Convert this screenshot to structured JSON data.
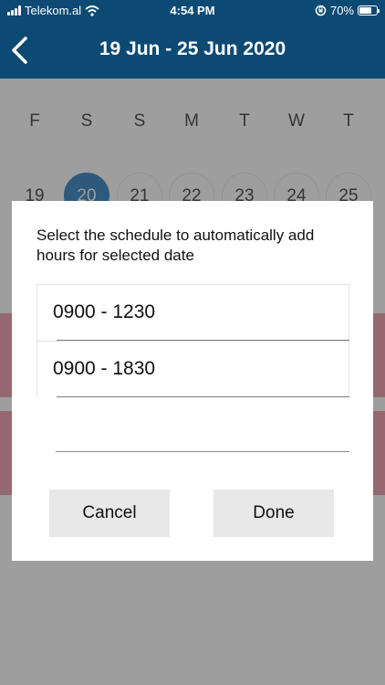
{
  "status_bar": {
    "carrier": "Telekom.al",
    "time": "4:54 PM",
    "battery": "70%"
  },
  "header": {
    "title": "19 Jun - 25 Jun 2020"
  },
  "calendar": {
    "weekdays": [
      "F",
      "S",
      "S",
      "M",
      "T",
      "W",
      "T"
    ],
    "dates": [
      "19",
      "20",
      "21",
      "22",
      "23",
      "24",
      "25"
    ],
    "selected_date": "20"
  },
  "dialog": {
    "message": "Select the schedule to automatically add hours for selected date",
    "options": [
      "0900 - 1230",
      "0900 - 1830"
    ],
    "cancel_label": "Cancel",
    "done_label": "Done"
  },
  "colors": {
    "header_bg": "#0c4a73",
    "selected_day": "#4a90c8",
    "event_band": "#f0a8b6"
  }
}
